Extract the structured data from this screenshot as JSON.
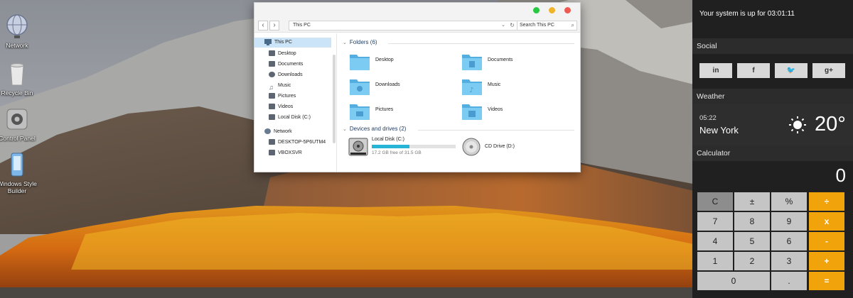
{
  "desktop": {
    "icons": [
      {
        "label": "Network",
        "icon": "network-globe-icon"
      },
      {
        "label": "Recycle Bin",
        "icon": "recycle-bin-icon"
      },
      {
        "label": "Control Panel",
        "icon": "control-panel-icon"
      },
      {
        "label": "Windows Style Builder",
        "icon": "style-builder-icon"
      }
    ]
  },
  "explorer": {
    "address": "This PC",
    "search_placeholder": "Search This PC",
    "nav": {
      "this_pc": "This PC",
      "items": [
        "Desktop",
        "Documents",
        "Downloads",
        "Music",
        "Pictures",
        "Videos",
        "Local Disk (C:)"
      ],
      "network": "Network",
      "network_items": [
        "DESKTOP-5P6UTM4",
        "VBOXSVR"
      ]
    },
    "folders_header": "Folders (6)",
    "folders": [
      "Desktop",
      "Documents",
      "Downloads",
      "Music",
      "Pictures",
      "Videos"
    ],
    "devices_header": "Devices and drives (2)",
    "drive_c": {
      "name": "Local Disk (C:)",
      "space": "17.2 GB free of 31.5 GB",
      "used_fraction": 0.45
    },
    "drive_d": {
      "name": "CD Drive (D:)"
    }
  },
  "sidebar": {
    "uptime": "Your system is up for 03:01:11",
    "social_header": "Social",
    "social": [
      {
        "label": "in",
        "icon": "linkedin-icon"
      },
      {
        "label": "f",
        "icon": "facebook-icon"
      },
      {
        "label": "🐦",
        "icon": "twitter-icon"
      },
      {
        "label": "g+",
        "icon": "google-plus-icon"
      }
    ],
    "weather_header": "Weather",
    "weather": {
      "time": "05:22",
      "city": "New York",
      "temp": "20°",
      "icon": "sun-icon"
    },
    "calculator_header": "Calculator",
    "calculator": {
      "display": "0",
      "keys": [
        "C",
        "±",
        "%",
        "÷",
        "7",
        "8",
        "9",
        "x",
        "4",
        "5",
        "6",
        "-",
        "1",
        "2",
        "3",
        "+",
        "0",
        ".",
        "="
      ]
    }
  },
  "colors": {
    "sidebar_bg": "#202020",
    "accent_orange": "#f0a30a",
    "selection_blue": "#cce4f7",
    "drive_fill": "#26b5d6",
    "folder_blue": "#6ec3ee"
  }
}
